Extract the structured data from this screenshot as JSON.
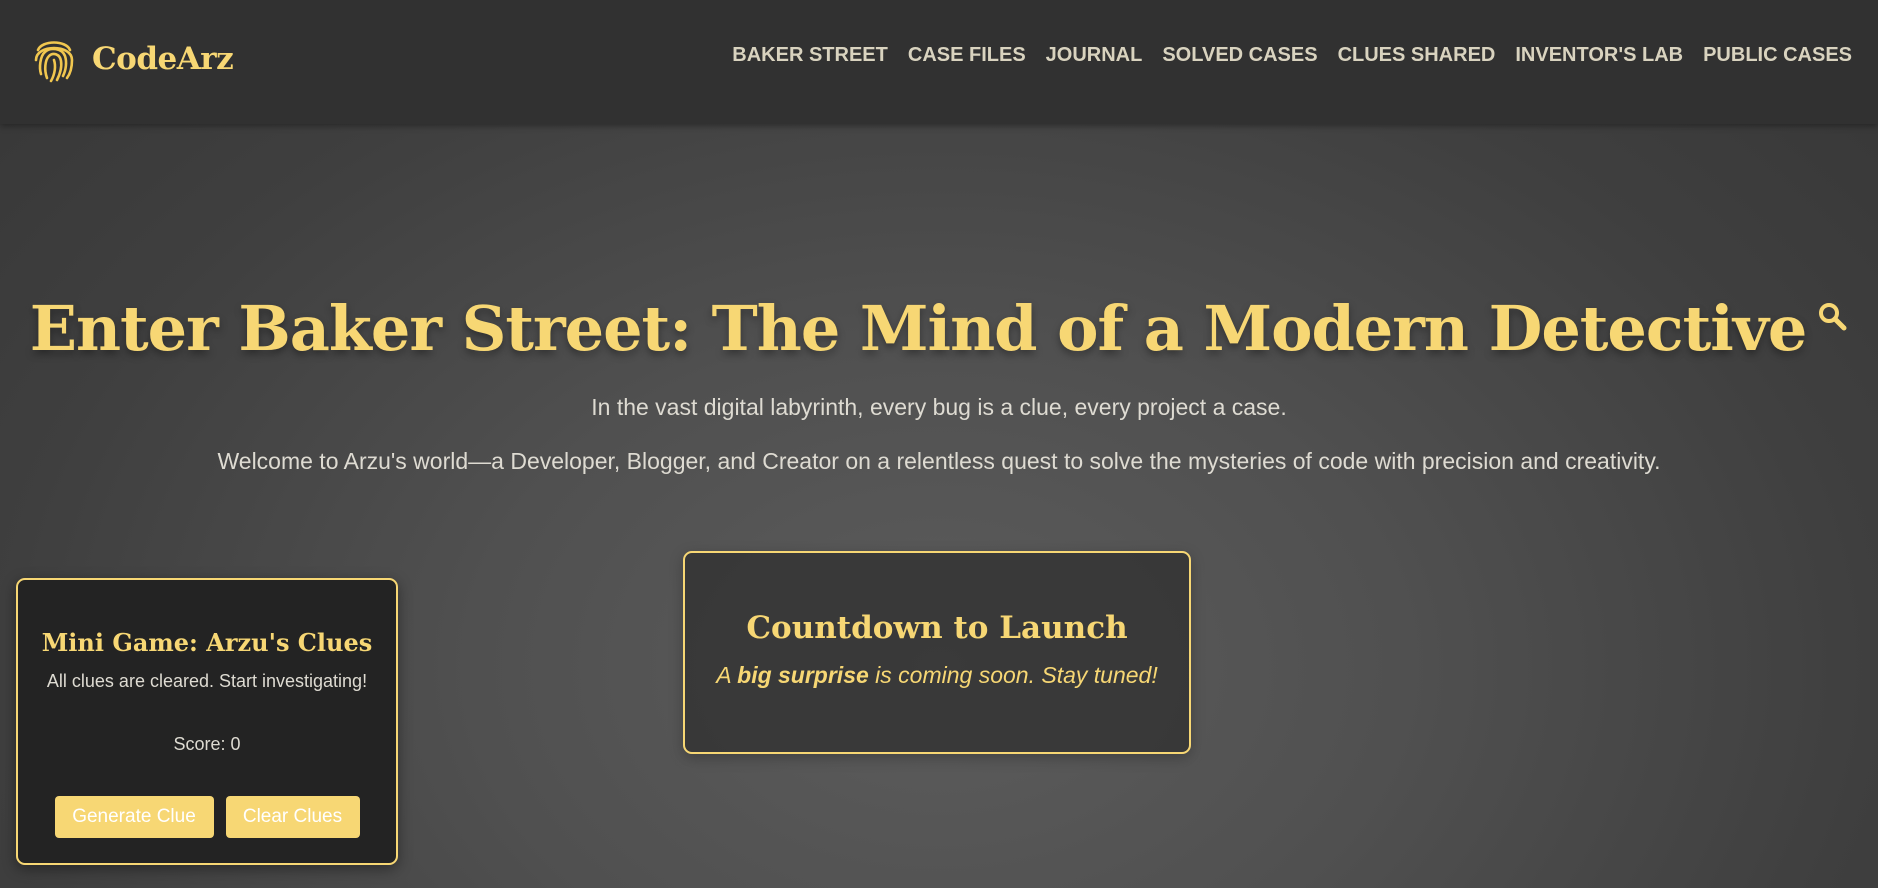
{
  "brand": {
    "name": "CodeArz",
    "icon": "fingerprint-icon"
  },
  "nav": {
    "items": [
      "BAKER STREET",
      "CASE FILES",
      "JOURNAL",
      "SOLVED CASES",
      "CLUES SHARED",
      "INVENTOR'S LAB",
      "PUBLIC CASES"
    ]
  },
  "hero": {
    "title": "Enter Baker Street: The Mind of a Modern Detective",
    "title_icon": "search-icon",
    "tagline1": "In the vast digital labyrinth, every bug is a clue, every project a case.",
    "tagline2": "Welcome to Arzu's world—a Developer, Blogger, and Creator on a relentless quest to solve the mysteries of code with precision and creativity."
  },
  "countdown": {
    "title": "Countdown to Launch",
    "text_before": "A ",
    "text_bold": "big surprise",
    "text_after": " is coming soon. Stay tuned!"
  },
  "mini_game": {
    "title": "Mini Game: Arzu's Clues",
    "status": "All clues are cleared. Start investigating!",
    "score": "Score: 0",
    "generate_label": "Generate Clue",
    "clear_label": "Clear Clues"
  },
  "colors": {
    "accent": "#f7d774",
    "navbar": "#313131",
    "text_light": "#dedbd2",
    "card_dark": "#232323"
  }
}
